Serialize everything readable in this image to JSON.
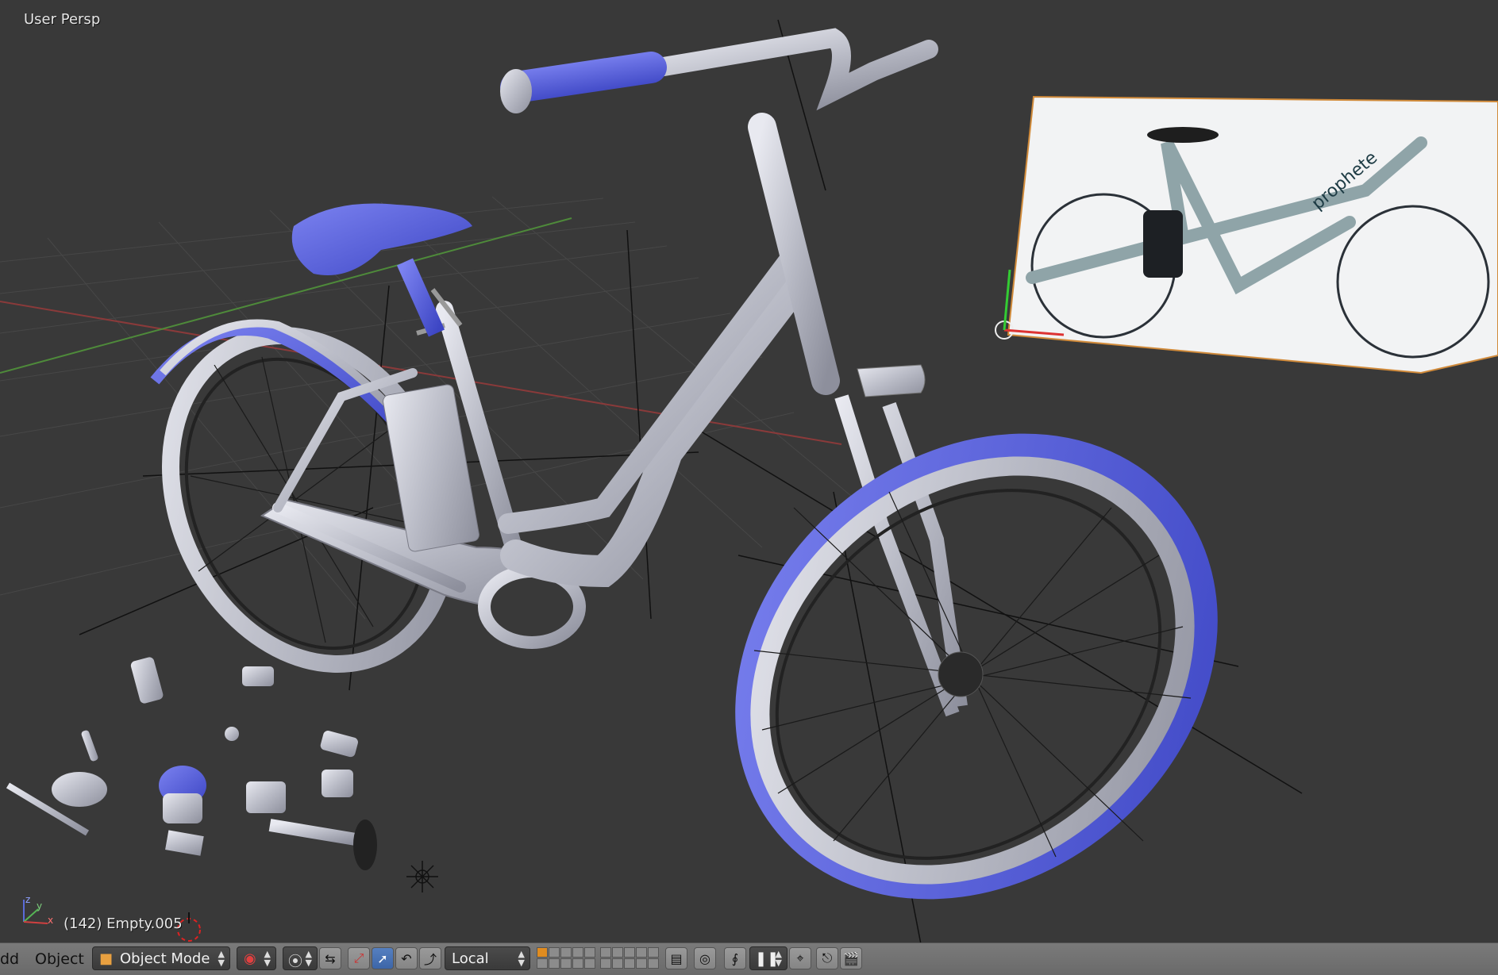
{
  "viewport": {
    "view_name": "User Persp",
    "object_info": "(142) Empty.005",
    "reference_image": {
      "brand": "prophete"
    },
    "gizmo_axes": [
      "z",
      "y",
      "x"
    ]
  },
  "header": {
    "menu_partial": "dd",
    "menu_object": "Object",
    "mode_label": "Object Mode",
    "orientation_label": "Local",
    "icons": [
      "draw-type-icon",
      "pivot-icon",
      "manipulator-icon",
      "translate-icon",
      "rotate-icon",
      "scale-icon",
      "layers-icon",
      "proportional-icon",
      "snap-icon",
      "snap-target-icon",
      "render-icon",
      "opengl-render-icon"
    ]
  },
  "colors": {
    "viewport_bg": "#393939",
    "header_bg": "#727272",
    "accent_blue": "#5560dd",
    "model_gray": "#c8c9d2",
    "selection_orange": "#e08c20"
  }
}
